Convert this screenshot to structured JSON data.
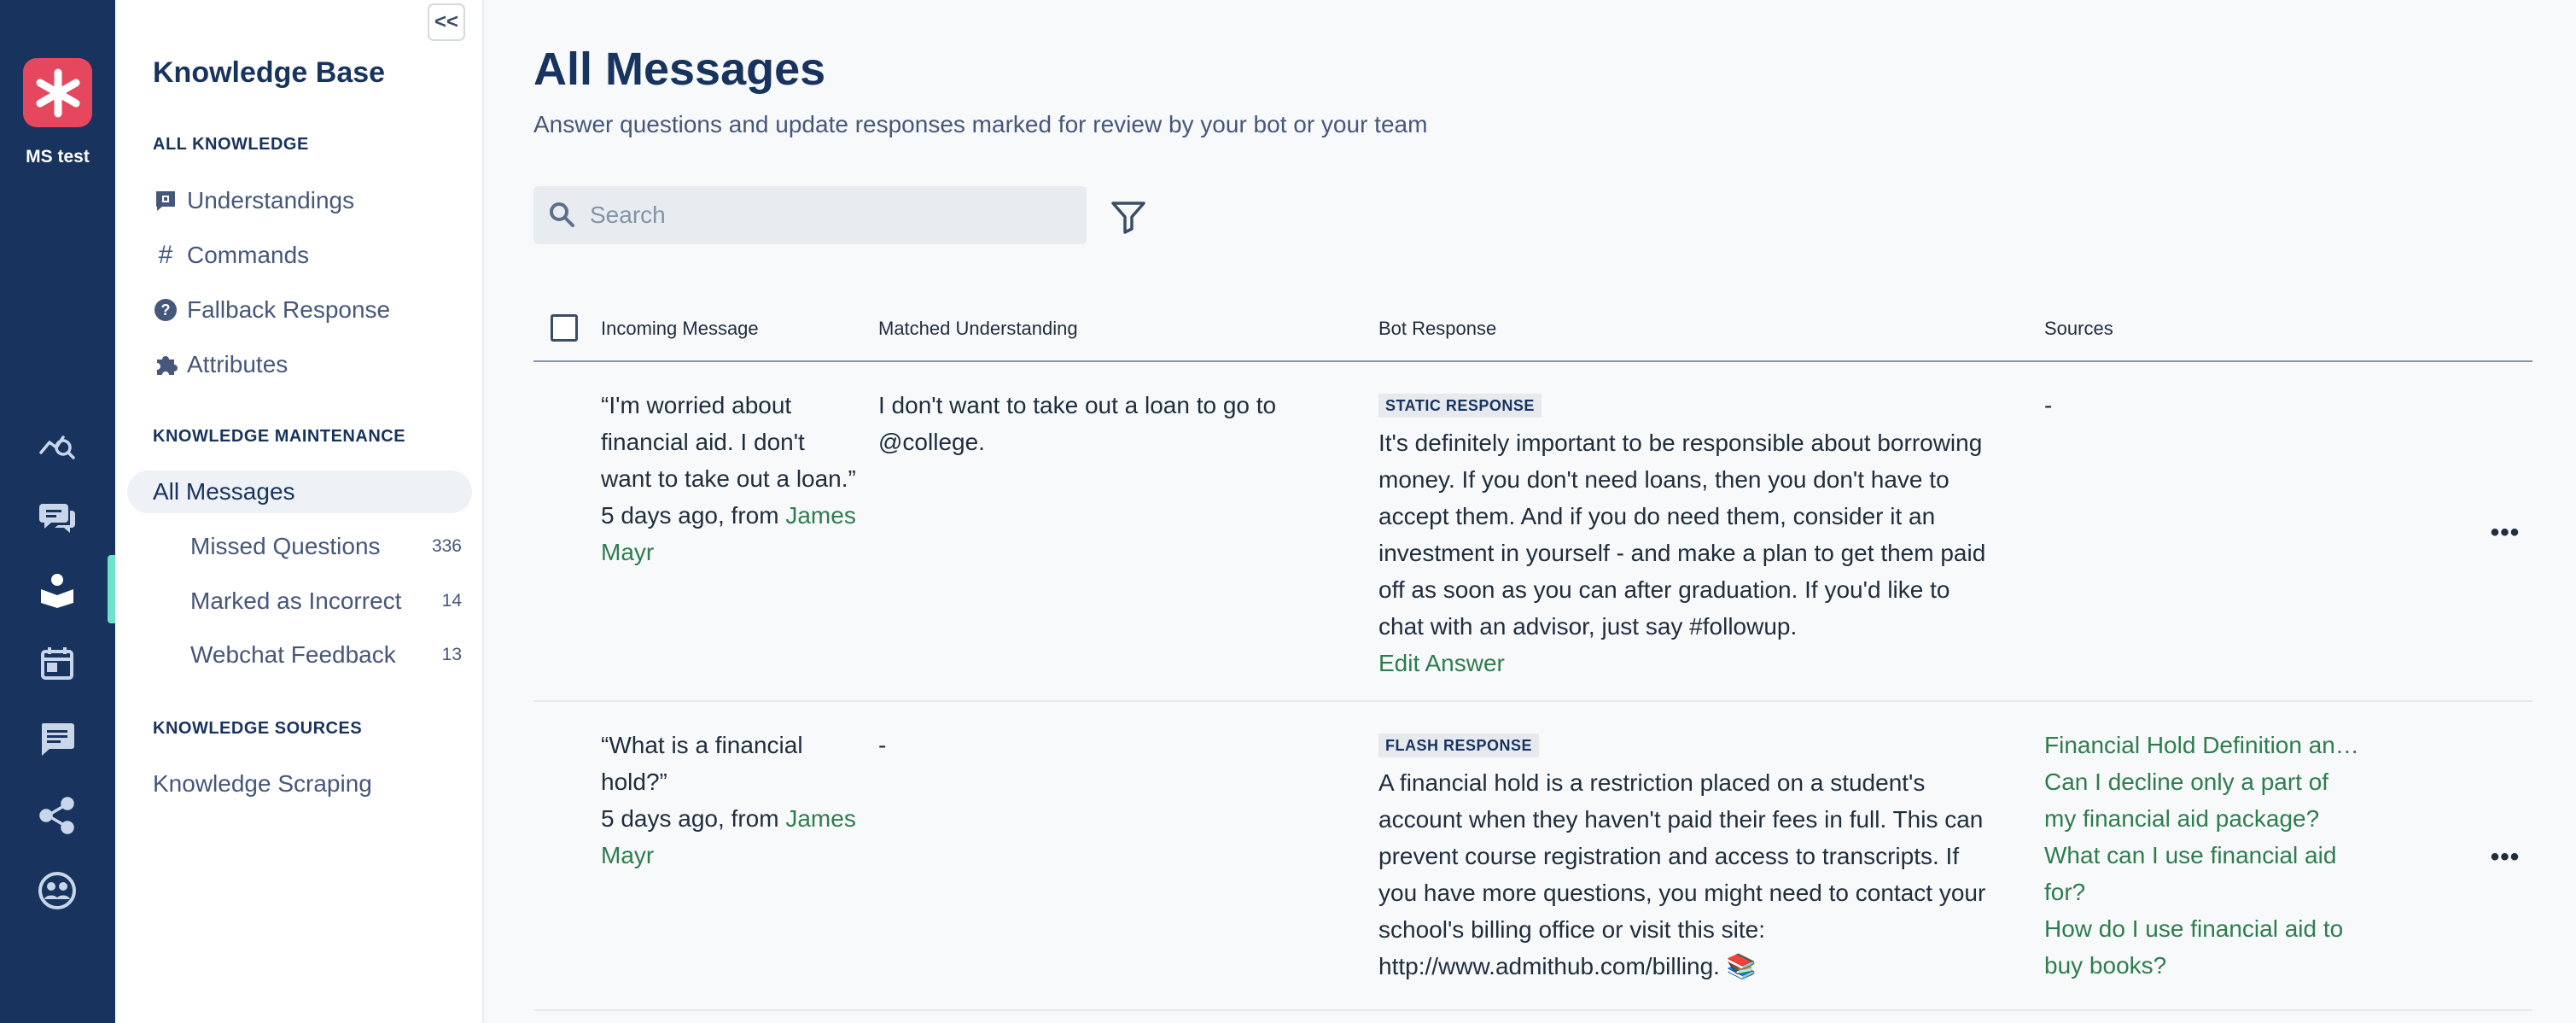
{
  "org": {
    "name": "MS test"
  },
  "sidebar": {
    "title": "Knowledge Base",
    "collapse_glyph": "<<",
    "sections": {
      "all_knowledge": "ALL KNOWLEDGE",
      "maintenance": "KNOWLEDGE MAINTENANCE",
      "sources": "KNOWLEDGE SOURCES"
    },
    "items": {
      "understandings": "Understandings",
      "commands": "Commands",
      "fallback": "Fallback Response",
      "attributes": "Attributes",
      "all_messages": "All Messages",
      "missed_questions": {
        "label": "Missed Questions",
        "count": "336"
      },
      "marked_incorrect": {
        "label": "Marked as Incorrect",
        "count": "14"
      },
      "webchat_feedback": {
        "label": "Webchat Feedback",
        "count": "13"
      },
      "knowledge_scraping": "Knowledge Scraping"
    }
  },
  "rail": {
    "icons": [
      "insights-icon",
      "conversations-icon",
      "knowledge-base-icon",
      "calendar-icon",
      "messages-icon",
      "integrations-icon",
      "audience-icon"
    ]
  },
  "page": {
    "title": "All Messages",
    "subtitle": "Answer questions and update responses marked for review by your bot or your team"
  },
  "search": {
    "placeholder": "Search",
    "value": ""
  },
  "table": {
    "headers": {
      "incoming": "Incoming Message",
      "matched": "Matched Understanding",
      "response": "Bot Response",
      "sources": "Sources"
    },
    "rows": [
      {
        "incoming": "“I'm worried about financial aid. I don't want to take out a loan.”",
        "meta_prefix": "5 days ago, from",
        "author": "James Mayr",
        "matched": "I don't want to take out a loan to go to @college.",
        "response_type": "STATIC RESPONSE",
        "response": "It's definitely important to be responsible about borrowing money. If you don't need loans, then you don't have to accept them. And if you do need them, consider it an investment in yourself - and make a plan to get them paid off as soon as you can after graduation. If you'd like to chat with an advisor, just say #followup.",
        "edit_label": "Edit Answer",
        "sources": [
          "-"
        ],
        "menu": "•••"
      },
      {
        "incoming": "“What is a financial hold?”",
        "meta_prefix": "5 days ago, from",
        "author": "James Mayr",
        "matched": "-",
        "response_type": "FLASH RESPONSE",
        "response": "A financial hold is a restriction placed on a student's account when they haven't paid their fees in full. This can prevent course registration and access to transcripts. If you have more questions, you might need to contact your school's billing office or visit this site: http://www.admithub.com/billing. 📚",
        "sources": [
          "Financial Hold Definition and Impact",
          "Can I decline only a part of my financial aid package?",
          "What can I use financial aid for?",
          "How do I use financial aid to buy books?"
        ],
        "menu": "•••"
      }
    ]
  }
}
